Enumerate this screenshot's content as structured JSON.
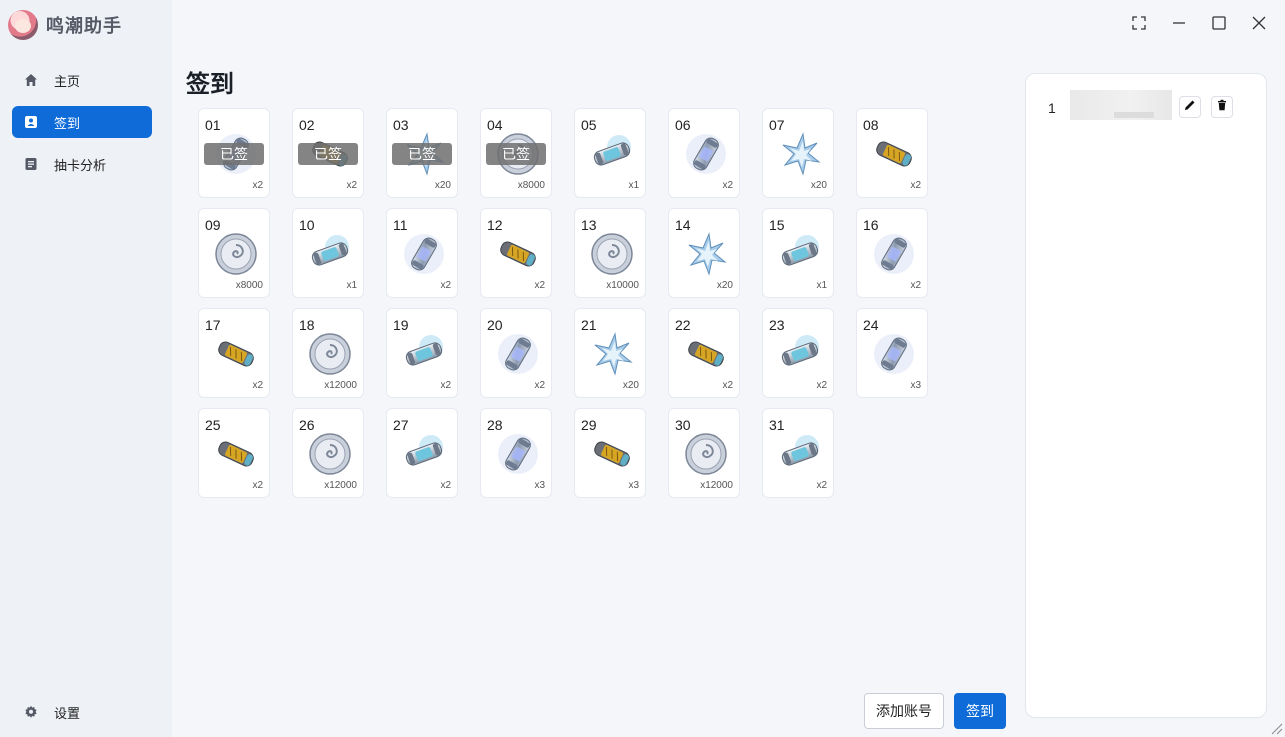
{
  "app": {
    "title": "鸣潮助手"
  },
  "sidebar": {
    "items": [
      {
        "label": "主页",
        "icon": "home-icon"
      },
      {
        "label": "签到",
        "icon": "badge-icon",
        "active": true
      },
      {
        "label": "抽卡分析",
        "icon": "document-icon"
      }
    ],
    "settings_label": "设置"
  },
  "main": {
    "title": "签到",
    "signed_label": "已签",
    "days": [
      {
        "day": "01",
        "item": "silver-capsule",
        "qty": "x2",
        "signed": true
      },
      {
        "day": "02",
        "item": "gold-capsule",
        "qty": "x2",
        "signed": true
      },
      {
        "day": "03",
        "item": "star-crystal",
        "qty": "x20",
        "signed": true
      },
      {
        "day": "04",
        "item": "shell-coin",
        "qty": "x8000",
        "signed": true
      },
      {
        "day": "05",
        "item": "blue-capsule",
        "qty": "x1",
        "signed": false
      },
      {
        "day": "06",
        "item": "silver-capsule",
        "qty": "x2",
        "signed": false
      },
      {
        "day": "07",
        "item": "star-crystal",
        "qty": "x20",
        "signed": false
      },
      {
        "day": "08",
        "item": "gold-capsule",
        "qty": "x2",
        "signed": false
      },
      {
        "day": "09",
        "item": "shell-coin",
        "qty": "x8000",
        "signed": false
      },
      {
        "day": "10",
        "item": "blue-capsule",
        "qty": "x1",
        "signed": false
      },
      {
        "day": "11",
        "item": "silver-capsule",
        "qty": "x2",
        "signed": false
      },
      {
        "day": "12",
        "item": "gold-capsule",
        "qty": "x2",
        "signed": false
      },
      {
        "day": "13",
        "item": "shell-coin",
        "qty": "x10000",
        "signed": false
      },
      {
        "day": "14",
        "item": "star-crystal",
        "qty": "x20",
        "signed": false
      },
      {
        "day": "15",
        "item": "blue-capsule",
        "qty": "x1",
        "signed": false
      },
      {
        "day": "16",
        "item": "silver-capsule",
        "qty": "x2",
        "signed": false
      },
      {
        "day": "17",
        "item": "gold-capsule",
        "qty": "x2",
        "signed": false
      },
      {
        "day": "18",
        "item": "shell-coin",
        "qty": "x12000",
        "signed": false
      },
      {
        "day": "19",
        "item": "blue-capsule",
        "qty": "x2",
        "signed": false
      },
      {
        "day": "20",
        "item": "silver-capsule",
        "qty": "x2",
        "signed": false
      },
      {
        "day": "21",
        "item": "star-crystal",
        "qty": "x20",
        "signed": false
      },
      {
        "day": "22",
        "item": "gold-capsule",
        "qty": "x2",
        "signed": false
      },
      {
        "day": "23",
        "item": "blue-capsule",
        "qty": "x2",
        "signed": false
      },
      {
        "day": "24",
        "item": "silver-capsule",
        "qty": "x3",
        "signed": false
      },
      {
        "day": "25",
        "item": "gold-capsule",
        "qty": "x2",
        "signed": false
      },
      {
        "day": "26",
        "item": "shell-coin",
        "qty": "x12000",
        "signed": false
      },
      {
        "day": "27",
        "item": "blue-capsule",
        "qty": "x2",
        "signed": false
      },
      {
        "day": "28",
        "item": "silver-capsule",
        "qty": "x3",
        "signed": false
      },
      {
        "day": "29",
        "item": "gold-capsule",
        "qty": "x3",
        "signed": false
      },
      {
        "day": "30",
        "item": "shell-coin",
        "qty": "x12000",
        "signed": false
      },
      {
        "day": "31",
        "item": "blue-capsule",
        "qty": "x2",
        "signed": false
      }
    ],
    "buttons": {
      "add_account": "添加账号",
      "sign": "签到"
    }
  },
  "accounts": [
    {
      "index": "1"
    }
  ],
  "window_controls": [
    "fullscreen-icon",
    "minimize-icon",
    "maximize-icon",
    "close-icon"
  ],
  "colors": {
    "accent": "#0e6bd8",
    "signed_overlay": "#6e6e6e"
  }
}
